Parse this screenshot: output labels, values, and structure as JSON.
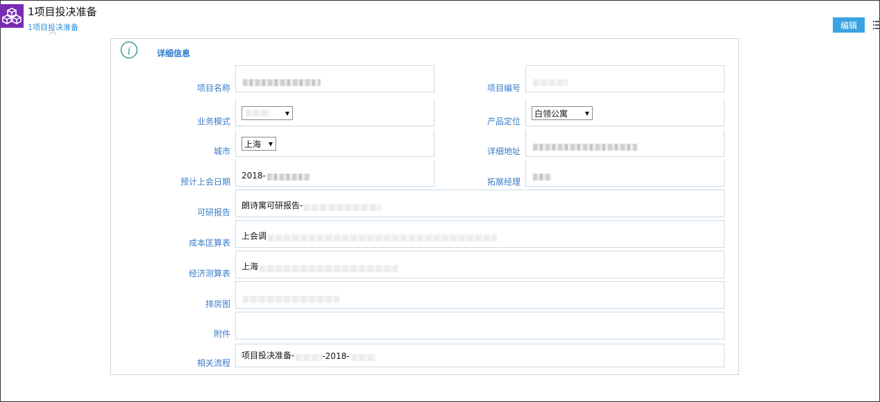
{
  "header": {
    "app_icon": "cubes-icon",
    "title": "1项目投决准备",
    "breadcrumb": "1项目投决准备",
    "edit_label": "编辑",
    "more_icon": "list-icon",
    "accent_color": "#3aa3e3",
    "logo_color": "#7a2bb3"
  },
  "section": {
    "title": "详细信息",
    "icon": "info-icon"
  },
  "fields": {
    "project_name": {
      "label": "项目名称",
      "value": ""
    },
    "project_code": {
      "label": "项目编号",
      "value": ""
    },
    "business_mode": {
      "label": "业务模式",
      "value": ""
    },
    "product_position": {
      "label": "产品定位",
      "value": "白领公寓"
    },
    "city": {
      "label": "城市",
      "value": "上海"
    },
    "address": {
      "label": "详细地址",
      "value": ""
    },
    "meeting_date": {
      "label": "预计上会日期",
      "value": "2018-"
    },
    "manager": {
      "label": "拓展经理",
      "value": ""
    },
    "feasibility_report": {
      "label": "可研报告",
      "value": "朗诗寓可研报告-"
    },
    "cost_sheet": {
      "label": "成本匡算表",
      "value": "上会调"
    },
    "economic_sheet": {
      "label": "经济测算表",
      "value": "上海"
    },
    "room_plan": {
      "label": "排房图",
      "value": ""
    },
    "attachment": {
      "label": "附件",
      "value": ""
    },
    "related_process": {
      "label": "相关流程",
      "value": "项目投决准备-",
      "value_2": "-2018-"
    }
  }
}
